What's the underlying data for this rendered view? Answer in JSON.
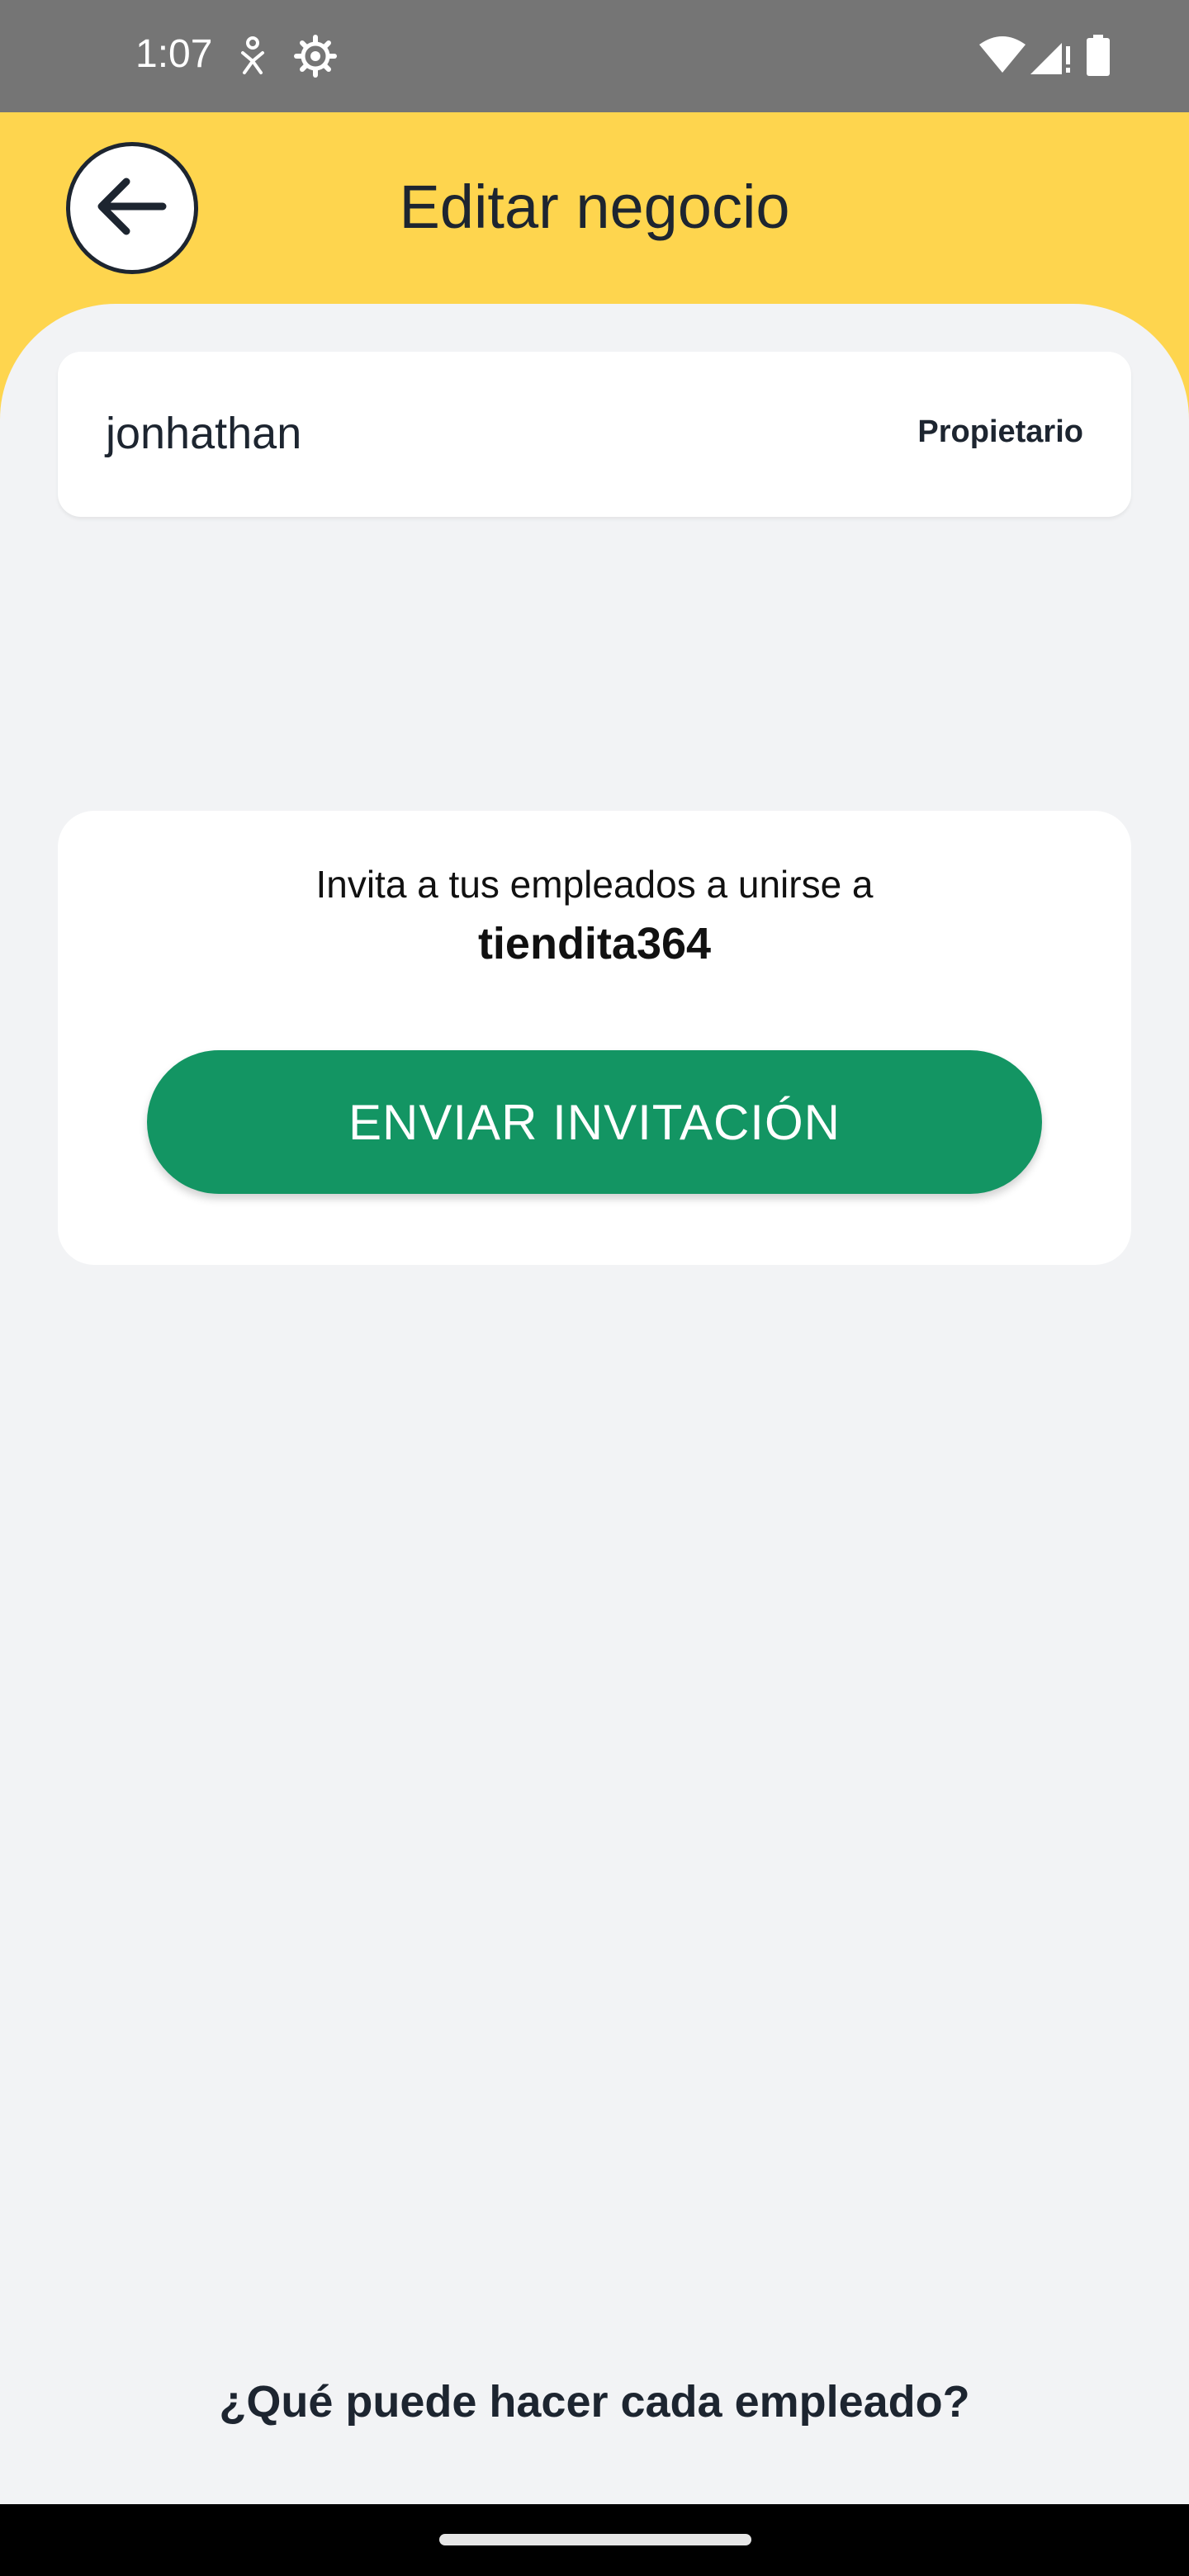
{
  "status_bar": {
    "time": "1:07",
    "icons": [
      "accessibility-icon",
      "settings-gear-icon",
      "wifi-icon",
      "signal-icon",
      "battery-icon"
    ]
  },
  "header": {
    "title": "Editar negocio",
    "back_icon": "arrow-left-icon",
    "background_color": "#fed54e"
  },
  "owner": {
    "name": "jonhathan",
    "role": "Propietario"
  },
  "invite": {
    "text": "Invita a tus empleados a unirse a",
    "business_name": "tiendita364",
    "button_label": "ENVIAR INVITACIÓN",
    "button_color": "#139563"
  },
  "footer": {
    "help_link": "¿Qué puede hacer cada empleado?"
  }
}
